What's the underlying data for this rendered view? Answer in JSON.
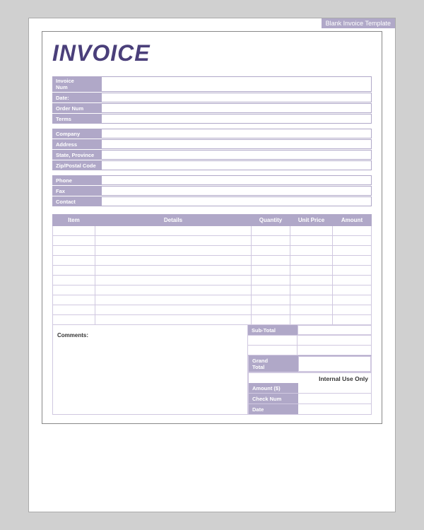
{
  "template": {
    "label": "Blank Invoice Template"
  },
  "invoice": {
    "title": "INVOICE"
  },
  "info": {
    "fields": [
      {
        "label": "Invoice\nNum",
        "value": ""
      },
      {
        "label": "Date:",
        "value": ""
      },
      {
        "label": "Order Num",
        "value": ""
      },
      {
        "label": "Terms",
        "value": ""
      }
    ],
    "company_fields": [
      {
        "label": "Company",
        "value": ""
      },
      {
        "label": "Address",
        "value": ""
      },
      {
        "label": "State, Province",
        "value": ""
      },
      {
        "label": "Zip/Postal Code",
        "value": ""
      }
    ],
    "contact_fields": [
      {
        "label": "Phone",
        "value": ""
      },
      {
        "label": "Fax",
        "value": ""
      },
      {
        "label": "Contact",
        "value": ""
      }
    ]
  },
  "table": {
    "headers": [
      "Item",
      "Details",
      "Quantity",
      "Unit Price",
      "Amount"
    ],
    "rows": [
      [
        "",
        "",
        "",
        "",
        ""
      ],
      [
        "",
        "",
        "",
        "",
        ""
      ],
      [
        "",
        "",
        "",
        "",
        ""
      ],
      [
        "",
        "",
        "",
        "",
        ""
      ],
      [
        "",
        "",
        "",
        "",
        ""
      ],
      [
        "",
        "",
        "",
        "",
        ""
      ],
      [
        "",
        "",
        "",
        "",
        ""
      ],
      [
        "",
        "",
        "",
        "",
        ""
      ],
      [
        "",
        "",
        "",
        "",
        ""
      ],
      [
        "",
        "",
        "",
        "",
        ""
      ]
    ]
  },
  "comments": {
    "label": "Comments:"
  },
  "totals": {
    "sub_total_label": "Sub-Total",
    "grand_total_label": "Grand\nTotal",
    "internal_use_label": "Internal Use Only"
  },
  "payment": {
    "fields": [
      {
        "label": "Amount ($)",
        "value": ""
      },
      {
        "label": "Check Num",
        "value": ""
      },
      {
        "label": "Date",
        "value": ""
      }
    ]
  }
}
